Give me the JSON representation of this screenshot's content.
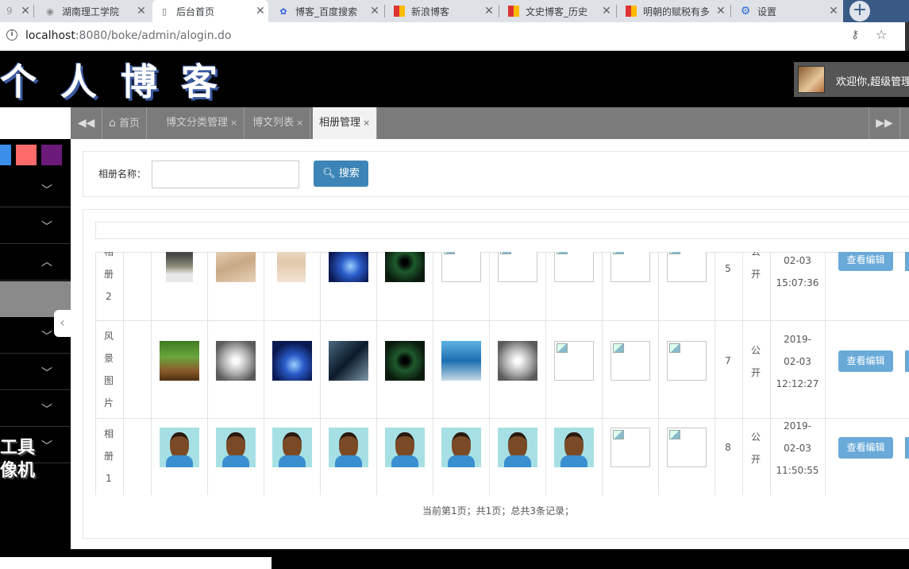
{
  "browser": {
    "tabs": [
      {
        "label": "湖南理工学院",
        "icon": "person-icon",
        "partial": "9"
      },
      {
        "label": "后台首页",
        "icon": "page-icon",
        "active": true
      },
      {
        "label": "博客_百度搜索",
        "icon": "baidu-paw-icon"
      },
      {
        "label": "新浪博客",
        "icon": "sina-icon"
      },
      {
        "label": "文史博客_历史",
        "icon": "sina-icon"
      },
      {
        "label": "明朝的赋税有多",
        "icon": "sina-icon"
      },
      {
        "label": "设置",
        "icon": "gear-icon"
      }
    ],
    "address_host": "localhost",
    "address_path": ":8080/boke/admin/alogin.do"
  },
  "header": {
    "logo": "个人博客",
    "welcome": "欢迎你,超级管理"
  },
  "nav": {
    "tabs": [
      {
        "label": "首页",
        "closable": false,
        "icon": "home-icon"
      },
      {
        "label": "博文分类管理",
        "closable": true
      },
      {
        "label": "博文列表",
        "closable": true
      },
      {
        "label": "相册管理",
        "closable": true,
        "active": true
      }
    ],
    "close_glyph": "×"
  },
  "sidebar": {
    "swatch_colors": [
      "#3b8eea",
      "#ff6b6b",
      "#6b1a7a"
    ],
    "watermark_lines": [
      "工具",
      "像机"
    ]
  },
  "search": {
    "label": "相册名称：",
    "input_value": "",
    "button_label": "搜索"
  },
  "table": {
    "rows": [
      {
        "name_chars": [
          "相",
          "册",
          "2"
        ],
        "images": [
          "office",
          "beige",
          "beige2",
          "blue",
          "tunnel",
          "broken",
          "broken",
          "broken",
          "broken",
          "broken"
        ],
        "count": "5",
        "visibility": [
          "公",
          "开"
        ],
        "datetime": [
          "02-03",
          "15:07:36"
        ],
        "edit_label": "查看编辑"
      },
      {
        "name_chars": [
          "风",
          "景",
          "图",
          "片"
        ],
        "images": [
          "forest",
          "arch",
          "blue",
          "space",
          "tunnel",
          "ocean",
          "arch",
          "broken",
          "broken",
          "broken"
        ],
        "count": "7",
        "visibility": [
          "公",
          "开"
        ],
        "datetime": [
          "2019-",
          "02-03",
          "12:12:27"
        ],
        "edit_label": "查看编辑"
      },
      {
        "name_chars": [
          "相",
          "册",
          "1"
        ],
        "images": [
          "face",
          "face",
          "face",
          "face",
          "face",
          "face",
          "face",
          "face",
          "broken",
          "broken"
        ],
        "count": "8",
        "visibility": [
          "公",
          "开"
        ],
        "datetime": [
          "2019-",
          "02-03",
          "11:50:55"
        ],
        "edit_label": "查看编辑"
      }
    ]
  },
  "pager": {
    "text": "当前第1页；共1页；总共3条记录；"
  }
}
